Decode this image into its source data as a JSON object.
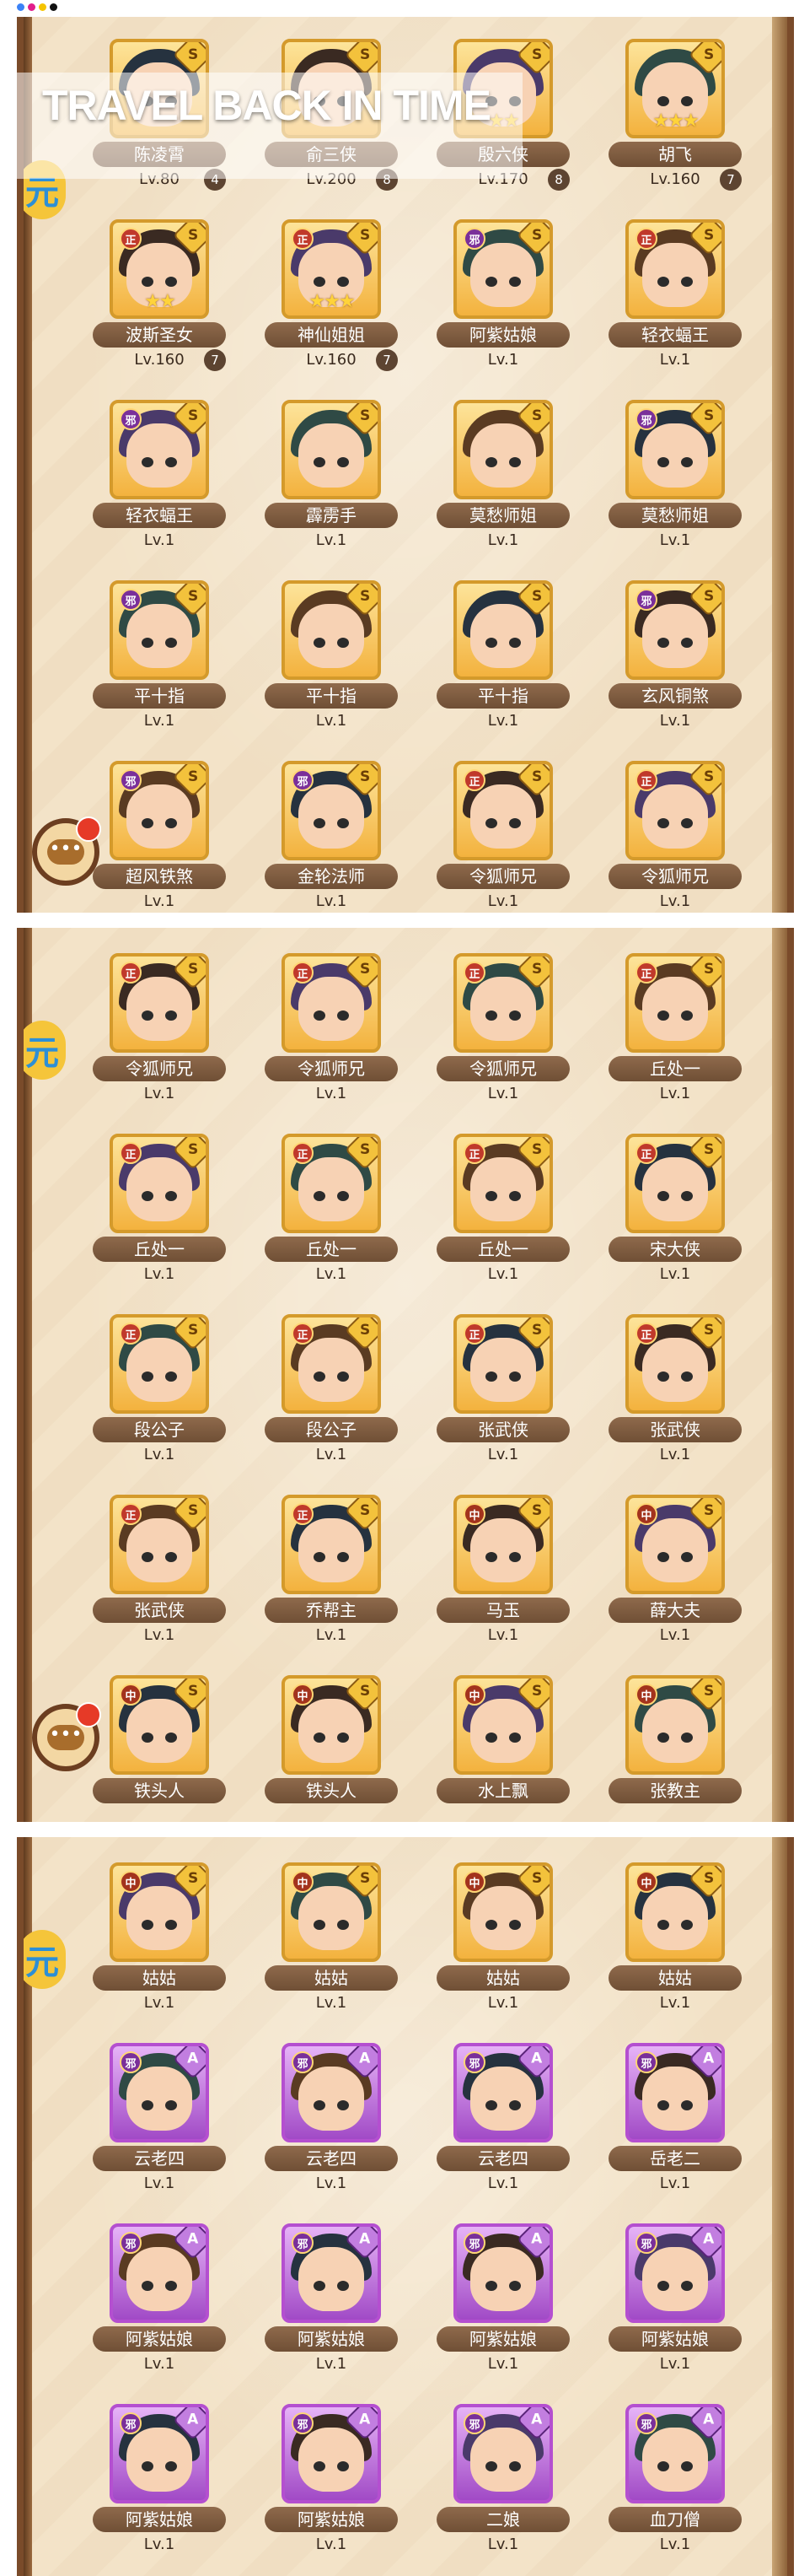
{
  "window_dots": [
    {
      "name": "blue-dot",
      "color": "#3b82f6"
    },
    {
      "name": "magenta-dot",
      "color": "#e11d8b"
    },
    {
      "name": "yellow-dot",
      "color": "#f5c400"
    },
    {
      "name": "black-dot",
      "color": "#111111"
    }
  ],
  "overlay": {
    "title": "TRAVEL BACK IN TIME"
  },
  "side_badge_label": "元",
  "chat_button": {
    "icon": "chat-bubble-icon",
    "glyph": "•••",
    "notification_color": "#e63a27"
  },
  "colors": {
    "zheng": "#c0392b",
    "xie": "#7a2f9a",
    "zhong": "#a3331d",
    "s_frame": "#d49a2b",
    "a_frame": "#b44fd0"
  },
  "faction_labels": {
    "zheng": "正",
    "xie": "邪",
    "zhong": "中"
  },
  "panels": [
    {
      "rows": [
        [
          {
            "name": "陈凌霄",
            "level": "Lv.80",
            "badge": "4",
            "rank": "S",
            "faction": "",
            "stars": ""
          },
          {
            "name": "俞三侠",
            "level": "Lv.200",
            "badge": "8",
            "rank": "S",
            "faction": "",
            "stars": ""
          },
          {
            "name": "殷六侠",
            "level": "Lv.170",
            "badge": "8",
            "rank": "S",
            "faction": "",
            "stars": "★★"
          },
          {
            "name": "胡飞",
            "level": "Lv.160",
            "badge": "7",
            "rank": "S",
            "faction": "",
            "stars": "★★★"
          }
        ],
        [
          {
            "name": "波斯圣女",
            "level": "Lv.160",
            "badge": "7",
            "rank": "S",
            "faction": "zheng",
            "stars": "★★"
          },
          {
            "name": "神仙姐姐",
            "level": "Lv.160",
            "badge": "7",
            "rank": "S",
            "faction": "zheng",
            "stars": "★★★"
          },
          {
            "name": "阿紫姑娘",
            "level": "Lv.1",
            "badge": "",
            "rank": "S",
            "faction": "xie",
            "stars": ""
          },
          {
            "name": "轻衣蝠王",
            "level": "Lv.1",
            "badge": "",
            "rank": "S",
            "faction": "zheng",
            "stars": ""
          }
        ],
        [
          {
            "name": "轻衣蝠王",
            "level": "Lv.1",
            "badge": "",
            "rank": "S",
            "faction": "xie",
            "stars": ""
          },
          {
            "name": "霹雳手",
            "level": "Lv.1",
            "badge": "",
            "rank": "S",
            "faction": "",
            "stars": ""
          },
          {
            "name": "莫愁师姐",
            "level": "Lv.1",
            "badge": "",
            "rank": "S",
            "faction": "",
            "stars": ""
          },
          {
            "name": "莫愁师姐",
            "level": "Lv.1",
            "badge": "",
            "rank": "S",
            "faction": "xie",
            "stars": ""
          }
        ],
        [
          {
            "name": "平十指",
            "level": "Lv.1",
            "badge": "",
            "rank": "S",
            "faction": "xie",
            "stars": ""
          },
          {
            "name": "平十指",
            "level": "Lv.1",
            "badge": "",
            "rank": "S",
            "faction": "",
            "stars": ""
          },
          {
            "name": "平十指",
            "level": "Lv.1",
            "badge": "",
            "rank": "S",
            "faction": "",
            "stars": ""
          },
          {
            "name": "玄风铜煞",
            "level": "Lv.1",
            "badge": "",
            "rank": "S",
            "faction": "xie",
            "stars": ""
          }
        ],
        [
          {
            "name": "超风铁煞",
            "level": "Lv.1",
            "badge": "",
            "rank": "S",
            "faction": "xie",
            "stars": ""
          },
          {
            "name": "金轮法师",
            "level": "Lv.1",
            "badge": "",
            "rank": "S",
            "faction": "xie",
            "stars": ""
          },
          {
            "name": "令狐师兄",
            "level": "Lv.1",
            "badge": "",
            "rank": "S",
            "faction": "zheng",
            "stars": ""
          },
          {
            "name": "令狐师兄",
            "level": "Lv.1",
            "badge": "",
            "rank": "S",
            "faction": "zheng",
            "stars": ""
          }
        ]
      ]
    },
    {
      "rows": [
        [
          {
            "name": "令狐师兄",
            "level": "Lv.1",
            "badge": "",
            "rank": "S",
            "faction": "zheng",
            "stars": ""
          },
          {
            "name": "令狐师兄",
            "level": "Lv.1",
            "badge": "",
            "rank": "S",
            "faction": "zheng",
            "stars": ""
          },
          {
            "name": "令狐师兄",
            "level": "Lv.1",
            "badge": "",
            "rank": "S",
            "faction": "zheng",
            "stars": ""
          },
          {
            "name": "丘处一",
            "level": "Lv.1",
            "badge": "",
            "rank": "S",
            "faction": "zheng",
            "stars": ""
          }
        ],
        [
          {
            "name": "丘处一",
            "level": "Lv.1",
            "badge": "",
            "rank": "S",
            "faction": "zheng",
            "stars": ""
          },
          {
            "name": "丘处一",
            "level": "Lv.1",
            "badge": "",
            "rank": "S",
            "faction": "zheng",
            "stars": ""
          },
          {
            "name": "丘处一",
            "level": "Lv.1",
            "badge": "",
            "rank": "S",
            "faction": "zheng",
            "stars": ""
          },
          {
            "name": "宋大侠",
            "level": "Lv.1",
            "badge": "",
            "rank": "S",
            "faction": "zheng",
            "stars": ""
          }
        ],
        [
          {
            "name": "段公子",
            "level": "Lv.1",
            "badge": "",
            "rank": "S",
            "faction": "zheng",
            "stars": ""
          },
          {
            "name": "段公子",
            "level": "Lv.1",
            "badge": "",
            "rank": "S",
            "faction": "zheng",
            "stars": ""
          },
          {
            "name": "张武侠",
            "level": "Lv.1",
            "badge": "",
            "rank": "S",
            "faction": "zheng",
            "stars": ""
          },
          {
            "name": "张武侠",
            "level": "Lv.1",
            "badge": "",
            "rank": "S",
            "faction": "zheng",
            "stars": ""
          }
        ],
        [
          {
            "name": "张武侠",
            "level": "Lv.1",
            "badge": "",
            "rank": "S",
            "faction": "zheng",
            "stars": ""
          },
          {
            "name": "乔帮主",
            "level": "Lv.1",
            "badge": "",
            "rank": "S",
            "faction": "zheng",
            "stars": ""
          },
          {
            "name": "马玉",
            "level": "Lv.1",
            "badge": "",
            "rank": "S",
            "faction": "zhong",
            "stars": ""
          },
          {
            "name": "薛大夫",
            "level": "Lv.1",
            "badge": "",
            "rank": "S",
            "faction": "zhong",
            "stars": ""
          }
        ],
        [
          {
            "name": "铁头人",
            "level": "",
            "badge": "",
            "rank": "S",
            "faction": "zhong",
            "stars": ""
          },
          {
            "name": "铁头人",
            "level": "",
            "badge": "",
            "rank": "S",
            "faction": "zhong",
            "stars": ""
          },
          {
            "name": "水上飘",
            "level": "",
            "badge": "",
            "rank": "S",
            "faction": "zhong",
            "stars": ""
          },
          {
            "name": "张教主",
            "level": "",
            "badge": "",
            "rank": "S",
            "faction": "zhong",
            "stars": ""
          }
        ]
      ]
    },
    {
      "rows": [
        [
          {
            "name": "姑姑",
            "level": "Lv.1",
            "badge": "",
            "rank": "S",
            "faction": "zhong",
            "stars": ""
          },
          {
            "name": "姑姑",
            "level": "Lv.1",
            "badge": "",
            "rank": "S",
            "faction": "zhong",
            "stars": ""
          },
          {
            "name": "姑姑",
            "level": "Lv.1",
            "badge": "",
            "rank": "S",
            "faction": "zhong",
            "stars": ""
          },
          {
            "name": "姑姑",
            "level": "Lv.1",
            "badge": "",
            "rank": "S",
            "faction": "zhong",
            "stars": ""
          }
        ],
        [
          {
            "name": "云老四",
            "level": "Lv.1",
            "badge": "",
            "rank": "A",
            "faction": "xie",
            "stars": ""
          },
          {
            "name": "云老四",
            "level": "Lv.1",
            "badge": "",
            "rank": "A",
            "faction": "xie",
            "stars": ""
          },
          {
            "name": "云老四",
            "level": "Lv.1",
            "badge": "",
            "rank": "A",
            "faction": "xie",
            "stars": ""
          },
          {
            "name": "岳老二",
            "level": "Lv.1",
            "badge": "",
            "rank": "A",
            "faction": "xie",
            "stars": ""
          }
        ],
        [
          {
            "name": "阿紫姑娘",
            "level": "Lv.1",
            "badge": "",
            "rank": "A",
            "faction": "xie",
            "stars": ""
          },
          {
            "name": "阿紫姑娘",
            "level": "Lv.1",
            "badge": "",
            "rank": "A",
            "faction": "xie",
            "stars": ""
          },
          {
            "name": "阿紫姑娘",
            "level": "Lv.1",
            "badge": "",
            "rank": "A",
            "faction": "xie",
            "stars": ""
          },
          {
            "name": "阿紫姑娘",
            "level": "Lv.1",
            "badge": "",
            "rank": "A",
            "faction": "xie",
            "stars": ""
          }
        ],
        [
          {
            "name": "阿紫姑娘",
            "level": "Lv.1",
            "badge": "",
            "rank": "A",
            "faction": "xie",
            "stars": ""
          },
          {
            "name": "阿紫姑娘",
            "level": "Lv.1",
            "badge": "",
            "rank": "A",
            "faction": "xie",
            "stars": ""
          },
          {
            "name": "二娘",
            "level": "Lv.1",
            "badge": "",
            "rank": "A",
            "faction": "xie",
            "stars": ""
          },
          {
            "name": "血刀僧",
            "level": "Lv.1",
            "badge": "",
            "rank": "A",
            "faction": "xie",
            "stars": ""
          }
        ]
      ]
    }
  ]
}
